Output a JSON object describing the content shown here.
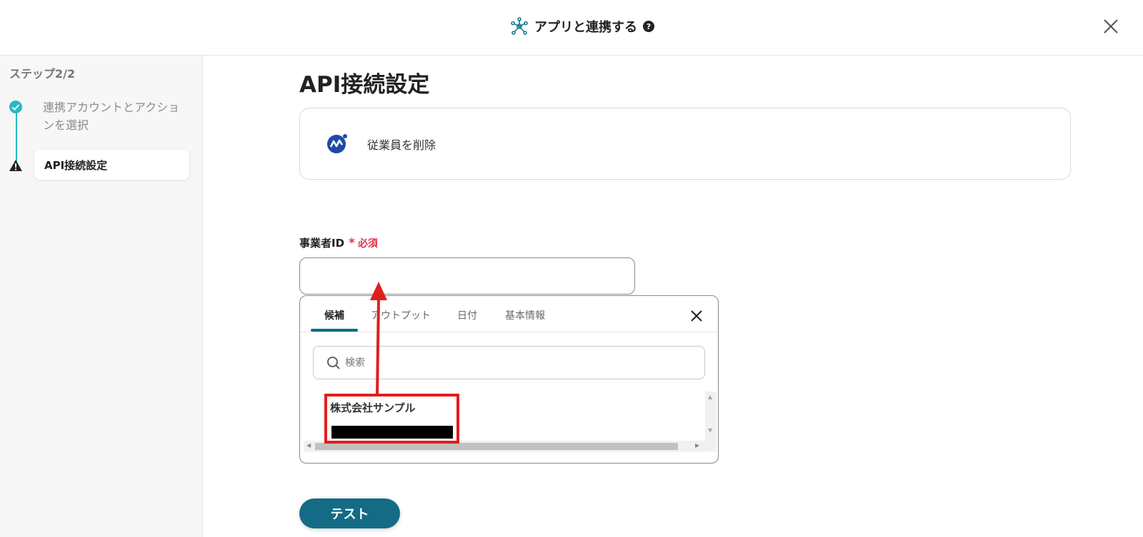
{
  "header": {
    "title": "アプリと連携する",
    "help_icon_glyph": "?"
  },
  "sidebar": {
    "step_label": "ステップ2/2",
    "steps": [
      {
        "label": "連携アカウントとアクションを選択",
        "status": "completed"
      },
      {
        "label": "API接続設定",
        "status": "warning"
      }
    ]
  },
  "main": {
    "page_title": "API接続設定",
    "action": {
      "name": "従業員を削除",
      "icon": "app-logo-icon"
    },
    "field": {
      "label": "事業者ID",
      "required_star": "*",
      "required_text": "必須",
      "value": "",
      "placeholder": ""
    },
    "dropdown": {
      "tabs": [
        "候補",
        "アウトプット",
        "日付",
        "基本情報"
      ],
      "active_tab": "候補",
      "search_placeholder": "検索",
      "items": [
        {
          "name": "株式会社サンプル"
        }
      ]
    },
    "test_button_label": "テスト"
  },
  "colors": {
    "accent": "#146b86",
    "step_done": "#27b9c9",
    "required": "#e0334a",
    "annotation": "#e01e1e"
  }
}
